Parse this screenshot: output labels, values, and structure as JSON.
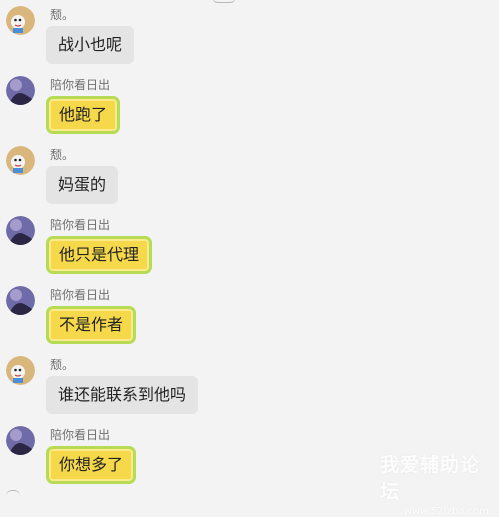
{
  "senders": {
    "a": "颓。",
    "b": "陪你看日出"
  },
  "messages": [
    {
      "sender": "颓。",
      "text": "战小也呢",
      "style": "gray"
    },
    {
      "sender": "陪你看日出",
      "text": "他跑了",
      "style": "yellow"
    },
    {
      "sender": "颓。",
      "text": "妈蛋的",
      "style": "gray"
    },
    {
      "sender": "陪你看日出",
      "text": "他只是代理",
      "style": "yellow"
    },
    {
      "sender": "陪你看日出",
      "text": "不是作者",
      "style": "yellow"
    },
    {
      "sender": "颓。",
      "text": "谁还能联系到他吗",
      "style": "gray"
    },
    {
      "sender": "陪你看日出",
      "text": "你想多了",
      "style": "yellow"
    }
  ],
  "watermark": {
    "title": "我爱辅助论坛",
    "url": "www.52fzba.com"
  },
  "colors": {
    "background": "#f3f3f3",
    "gray_bubble": "#e4e4e4",
    "yellow_bubble": "#f6d94a",
    "yellow_border": "#b6dc55"
  }
}
